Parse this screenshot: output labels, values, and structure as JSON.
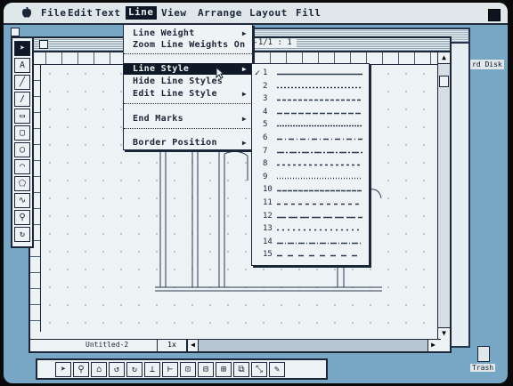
{
  "menubar": {
    "items": [
      {
        "label": "File",
        "key": "file"
      },
      {
        "label": "Edit",
        "key": "edit"
      },
      {
        "label": "Text",
        "key": "text"
      },
      {
        "label": "Line",
        "key": "line",
        "selected": true
      },
      {
        "label": "View",
        "key": "view"
      },
      {
        "label": "Arrange",
        "key": "arrange"
      },
      {
        "label": "Layout",
        "key": "layout"
      },
      {
        "label": "Fill",
        "key": "fill"
      }
    ]
  },
  "document": {
    "title": "Y-1/1 : 1",
    "filename": "Untitled-2",
    "zoom": "1x"
  },
  "desktop": {
    "disk_label": "rd Disk",
    "trash_label": "Trash"
  },
  "line_menu": {
    "items": [
      {
        "label": "Line Weight",
        "has_submenu": true
      },
      {
        "label": "Zoom Line Weights On",
        "has_submenu": false
      },
      {
        "label": "Line Style",
        "has_submenu": true,
        "highlighted": true
      },
      {
        "label": "Hide Line Styles",
        "has_submenu": false
      },
      {
        "label": "Edit Line Style",
        "has_submenu": true
      },
      {
        "label": "End Marks",
        "has_submenu": true
      },
      {
        "label": "Border Position",
        "has_submenu": true
      }
    ]
  },
  "line_style_submenu": {
    "check": "✓",
    "styles": [
      "1",
      "2",
      "3",
      "4",
      "5",
      "6",
      "7",
      "8",
      "9",
      "10",
      "11",
      "12",
      "13",
      "14",
      "15"
    ],
    "checked_index": 0
  },
  "colors": {
    "desktop": "#78a7c6",
    "menu_highlight": "#0f1826",
    "window_bg": "#edf2f4"
  }
}
